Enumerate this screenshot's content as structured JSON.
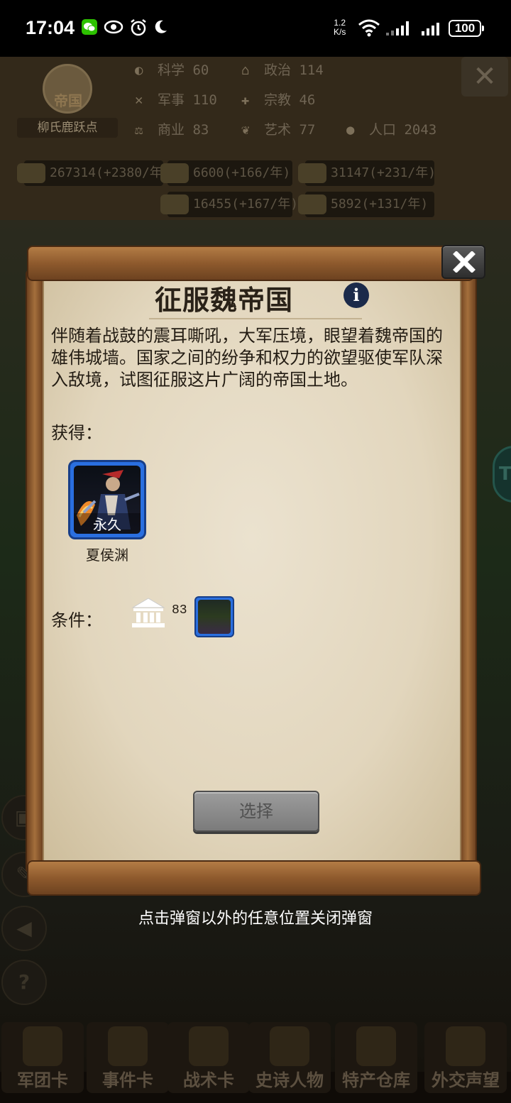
{
  "status_bar": {
    "time": "17:04",
    "net_speed_value": "1.2",
    "net_speed_unit": "K/s",
    "battery": "100"
  },
  "background": {
    "emblem": {
      "title": "帝国",
      "name": "柳氏鹿跃点"
    },
    "stats": [
      {
        "icon": "science-icon",
        "label": "科学",
        "value": "60"
      },
      {
        "icon": "politics-icon",
        "label": "政治",
        "value": "114"
      },
      {
        "icon": "military-icon",
        "label": "军事",
        "value": "110"
      },
      {
        "icon": "religion-icon",
        "label": "宗教",
        "value": "46"
      },
      {
        "icon": "commerce-icon",
        "label": "商业",
        "value": "83"
      },
      {
        "icon": "art-icon",
        "label": "艺术",
        "value": "77"
      },
      {
        "icon": "population-icon",
        "label": "人口",
        "value": "2043"
      }
    ],
    "resources": [
      {
        "icon": "gold-icon",
        "text": "267314(+2380/年)"
      },
      {
        "icon": "wood-icon",
        "text": "6600(+166/年)"
      },
      {
        "icon": "iron-icon",
        "text": "31147(+231/年)"
      },
      {
        "icon": "stone-icon",
        "text": "16455(+167/年)"
      },
      {
        "icon": "meat-icon",
        "text": "5892(+131/年)"
      }
    ],
    "bottom_nav": [
      "军团卡",
      "事件卡",
      "战术卡",
      "史诗人物",
      "特产仓库",
      "外交声望"
    ]
  },
  "dialog": {
    "title": "征服魏帝国",
    "description": "伴随着战鼓的震耳嘶吼，大军压境，眼望着魏帝国的雄伟城墙。国家之间的纷争和权力的欲望驱使军队深入敌境，试图征服这片广阔的帝国土地。",
    "gain_label": "获得：",
    "reward": {
      "tag": "永久",
      "name": "夏侯渊"
    },
    "condition_label": "条件：",
    "condition": {
      "icon": "politics-icon",
      "value": "83"
    },
    "select_button": "选择"
  },
  "hint": "点击弹窗以外的任意位置关闭弹窗",
  "colors": {
    "parchment": "#e6dcc6",
    "scroll_wood": "#8e5a2d",
    "card_blue": "#2a6fe0",
    "button_gray": "#8a8a8a"
  }
}
